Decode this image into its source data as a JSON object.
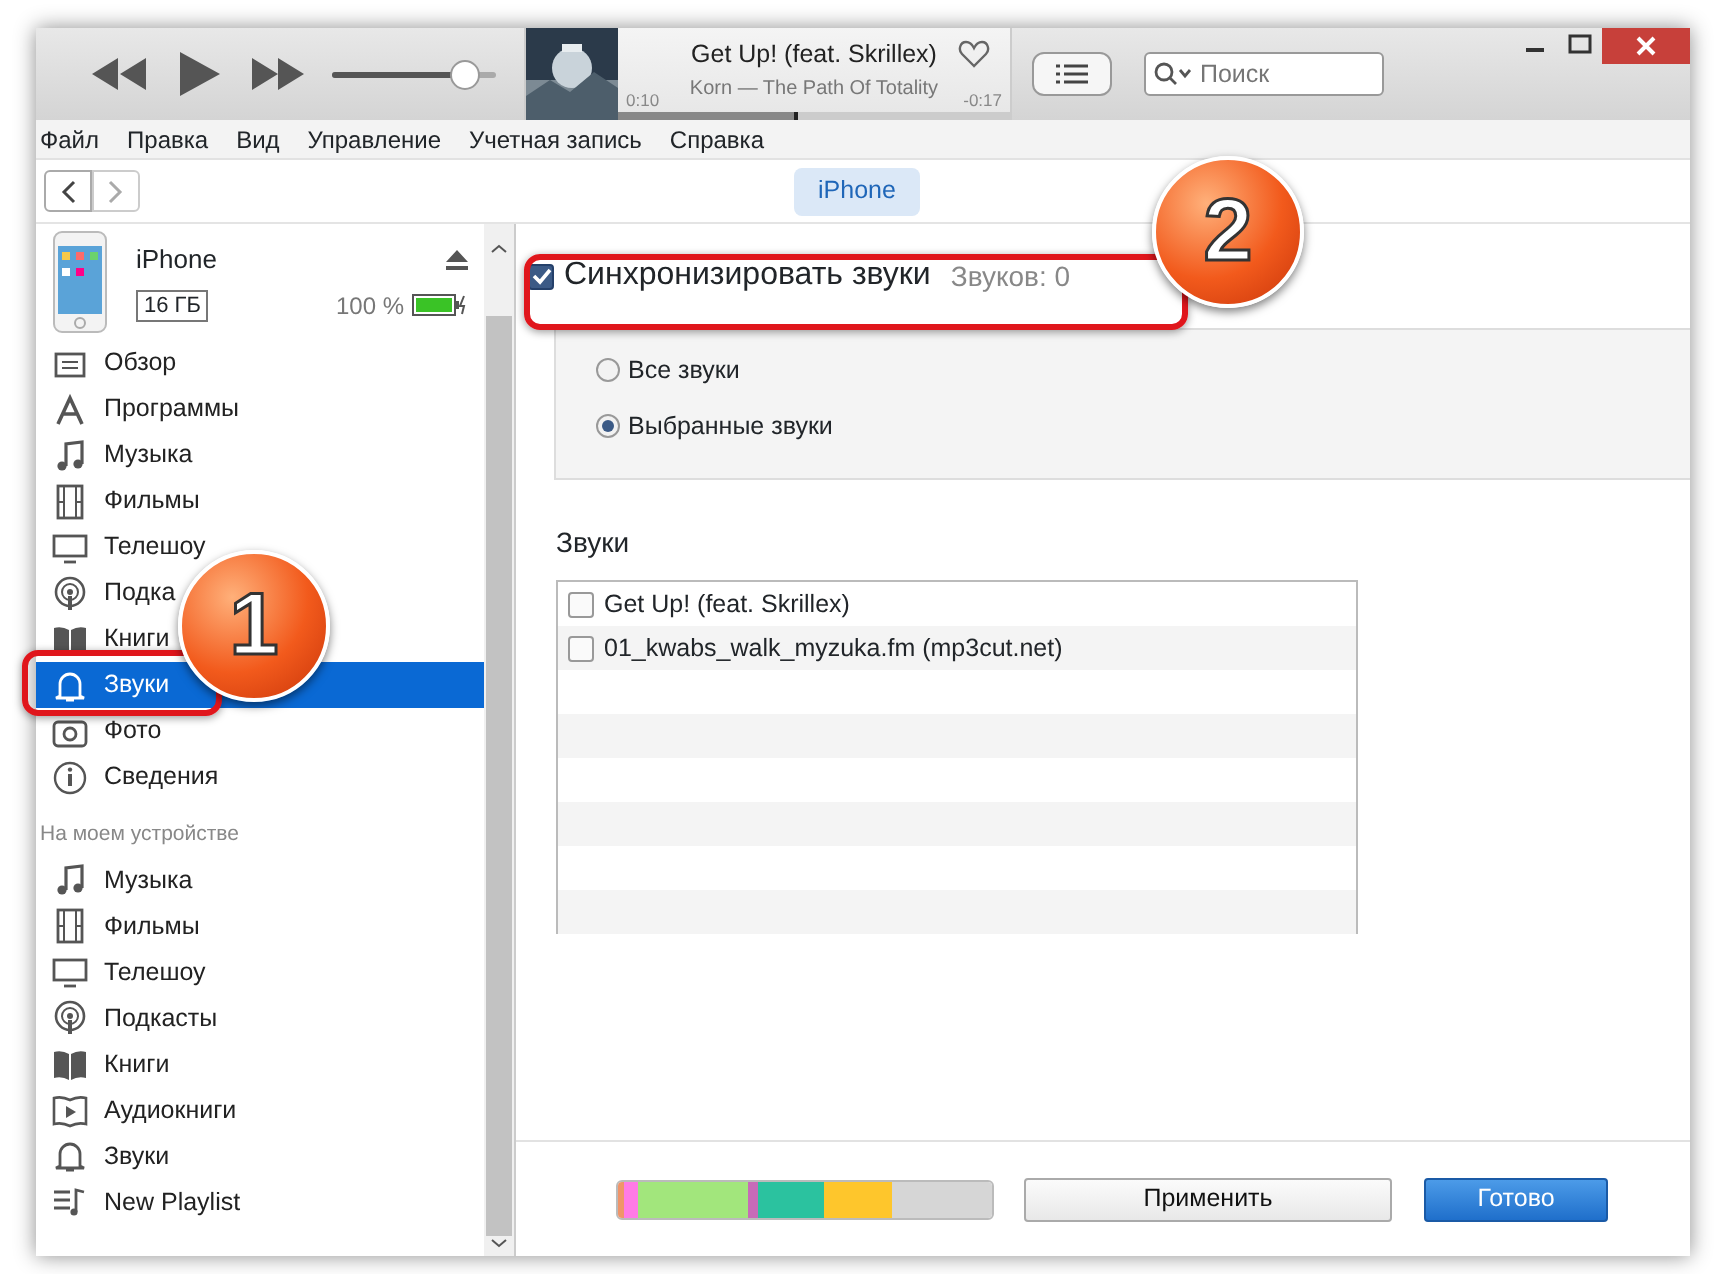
{
  "player": {
    "volume": {
      "level": 0.82
    },
    "now_playing": {
      "title": "Get Up! (feat. Skrillex)",
      "subtitle": "Korn — The Path Of Totality",
      "elapsed": "0:10",
      "remaining": "-0:17",
      "progress": {
        "level": 0.46
      }
    },
    "search": {
      "placeholder": "Поиск"
    }
  },
  "menu": [
    "Файл",
    "Правка",
    "Вид",
    "Управление",
    "Учетная запись",
    "Справка"
  ],
  "device_tab": {
    "label": "iPhone",
    "selected": true
  },
  "device": {
    "name": "iPhone",
    "capacity": "16 ГБ",
    "battery_text": "100 %"
  },
  "sidebar": {
    "settings": [
      {
        "kind": "summary",
        "label": "Обзор",
        "selected": false
      },
      {
        "kind": "apps",
        "label": "Программы",
        "selected": false
      },
      {
        "kind": "music",
        "label": "Музыка",
        "selected": false
      },
      {
        "kind": "movies",
        "label": "Фильмы",
        "selected": false
      },
      {
        "kind": "tv",
        "label": "Телешоу",
        "selected": false
      },
      {
        "kind": "podcasts",
        "label": "Подка",
        "selected": false
      },
      {
        "kind": "books",
        "label": "Книги",
        "selected": false
      },
      {
        "kind": "tones",
        "label": "Звуки",
        "selected": true
      },
      {
        "kind": "photos",
        "label": "Фото",
        "selected": false
      },
      {
        "kind": "info",
        "label": "Сведения",
        "selected": false
      }
    ],
    "section_title": "На моем устройстве",
    "on_device": [
      {
        "kind": "music",
        "label": "Музыка",
        "selected": false
      },
      {
        "kind": "movies",
        "label": "Фильмы",
        "selected": false
      },
      {
        "kind": "tv",
        "label": "Телешоу",
        "selected": false
      },
      {
        "kind": "podcasts",
        "label": "Подкасты",
        "selected": false
      },
      {
        "kind": "books",
        "label": "Книги",
        "selected": false
      },
      {
        "kind": "audiobooks",
        "label": "Аудиокниги",
        "selected": false
      },
      {
        "kind": "tones",
        "label": "Звуки",
        "selected": false
      },
      {
        "kind": "playlist",
        "label": "New Playlist",
        "selected": false
      }
    ]
  },
  "sync": {
    "label": "Синхронизировать звуки",
    "checked": true,
    "count": "Звуков: 0"
  },
  "options": [
    {
      "label": "Все звуки",
      "selected": false
    },
    {
      "label": "Выбранные звуки",
      "selected": true
    }
  ],
  "tones": {
    "title": "Звуки",
    "items": [
      {
        "name": "Get Up! (feat. Skrillex)",
        "checked": false
      },
      {
        "name": "01_kwabs_walk_myzuka.fm (mp3cut.net)",
        "checked": false
      }
    ]
  },
  "storage": [
    {
      "color": "#f0956a"
    },
    {
      "color": "#ff7be6"
    },
    {
      "color": "#a2e67c"
    },
    {
      "color": "#c76bb8"
    },
    {
      "color": "#2bc29f"
    },
    {
      "color": "#fec62c"
    },
    {
      "color": "#d6d6d6"
    }
  ],
  "buttons": [
    {
      "label": "Применить",
      "kind": "secondary"
    },
    {
      "label": "Готово",
      "kind": "primary"
    }
  ],
  "callouts": [
    {
      "label": "1"
    },
    {
      "label": "2"
    }
  ]
}
